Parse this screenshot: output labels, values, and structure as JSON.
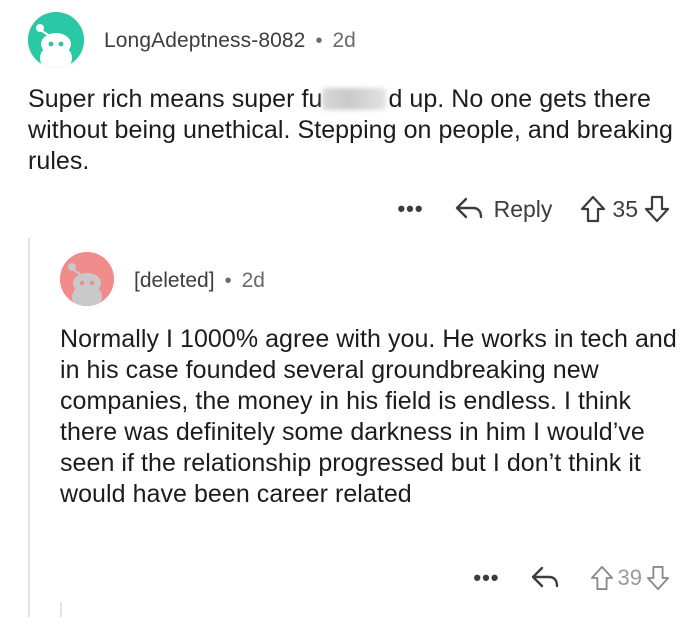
{
  "top_comment": {
    "username": "LongAdeptness-8082",
    "separator": "•",
    "age": "2d",
    "body_line1_before": "Super rich means super fu",
    "body_line1_after": "d up. No one gets",
    "body_rest": "there without being unethical. Stepping on people, and breaking rules.",
    "more_label": "•••",
    "reply_label": "Reply",
    "vote_count": "35",
    "avatar_color": "#2cc7a4",
    "avatar_icon": "snoo-avatar-icon"
  },
  "reply_comment": {
    "username": "[deleted]",
    "separator": "•",
    "age": "2d",
    "body": "Normally I 1000% agree with you. He works in tech and in his case founded several groundbreaking new companies, the money in his field is endless. I think there was definitely some darkness in him I would’ve seen if the relationship progressed but I don’t think it would have been career related",
    "more_label": "•••",
    "vote_count": "39",
    "avatar_color": "#f08c8c",
    "avatar_icon": "snoo-avatar-icon"
  }
}
